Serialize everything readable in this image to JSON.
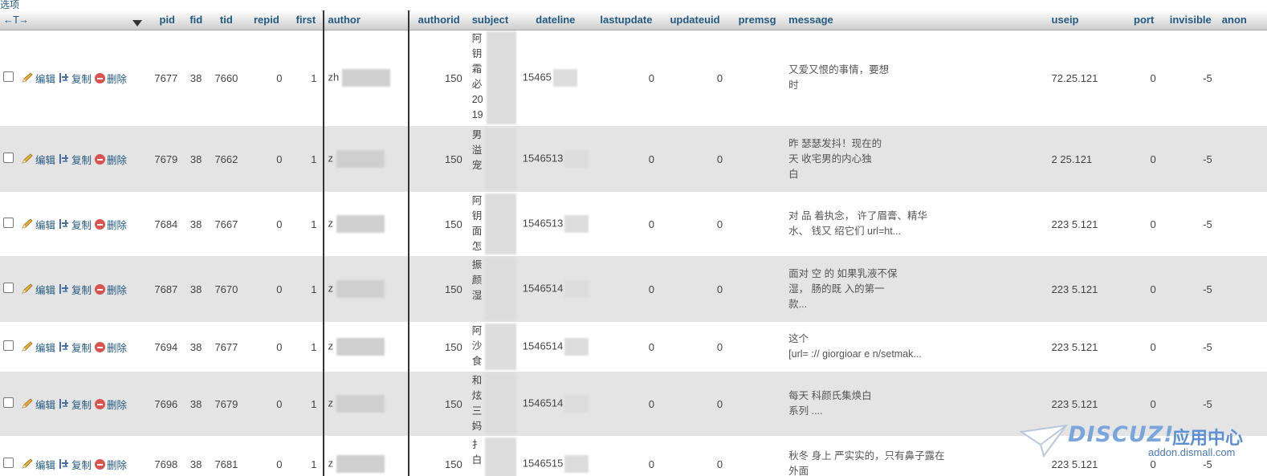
{
  "top_link": "选项",
  "header": {
    "nav": "←T→",
    "columns": [
      "pid",
      "fid",
      "tid",
      "repid",
      "first",
      "author",
      "authorid",
      "subject",
      "dateline",
      "lastupdate",
      "updateuid",
      "premsg",
      "message",
      "useip",
      "port",
      "invisible",
      "anon"
    ]
  },
  "actions": {
    "edit": "编辑",
    "copy": "复制",
    "delete": "删除"
  },
  "rows": [
    {
      "pid": "7677",
      "fid": "38",
      "tid": "7660",
      "repid": "0",
      "first": "1",
      "author": "zh",
      "authorid": "150",
      "subject": [
        "阿",
        "钥",
        "霜",
        "必",
        "20",
        "19"
      ],
      "dateline": "15465",
      "lastupdate": "0",
      "updateuid": "0",
      "message": [
        "",
        "又爱又恨的事情，要想",
        "时"
      ],
      "useip": "72.25.121",
      "port": "0",
      "invisible": "-5"
    },
    {
      "pid": "7679",
      "fid": "38",
      "tid": "7662",
      "repid": "0",
      "first": "1",
      "author": "z",
      "authorid": "150",
      "subject": [
        "男",
        "溢",
        "宠"
      ],
      "dateline": "1546513",
      "lastupdate": "0",
      "updateuid": "0",
      "message": [
        "昨                                    瑟瑟发抖！现在的",
        "天                                   收宅男的内心独",
        "白"
      ],
      "useip": "2   25.121",
      "port": "0",
      "invisible": "-5"
    },
    {
      "pid": "7684",
      "fid": "38",
      "tid": "7667",
      "repid": "0",
      "first": "1",
      "author": "z",
      "authorid": "150",
      "subject": [
        "阿",
        "钥",
        "面",
        "怎"
      ],
      "dateline": "1546513",
      "lastupdate": "0",
      "updateuid": "0",
      "message": [
        "对          品     着执念，     许了眉膏、精华",
        "水、        钱又    绍它们     url=ht..."
      ],
      "useip": "223   5.121",
      "port": "0",
      "invisible": "-5"
    },
    {
      "pid": "7687",
      "fid": "38",
      "tid": "7670",
      "repid": "0",
      "first": "1",
      "author": "z",
      "authorid": "150",
      "subject": [
        "振",
        "颜",
        "湿"
      ],
      "dateline": "1546514",
      "lastupdate": "0",
      "updateuid": "0",
      "message": [
        "面对          空     的    如果乳液不保",
        "湿，        肠的既        入的第一",
        "款..."
      ],
      "useip": "223   5.121",
      "port": "0",
      "invisible": "-5"
    },
    {
      "pid": "7694",
      "fid": "38",
      "tid": "7677",
      "repid": "0",
      "first": "1",
      "author": "z",
      "authorid": "150",
      "subject": [
        "阿",
        "沙",
        "食"
      ],
      "dateline": "1546514",
      "lastupdate": "0",
      "updateuid": "0",
      "message": [
        "这个",
        "[url=     ://    giorgioar      e     n/setmak..."
      ],
      "useip": "223   5.121",
      "port": "0",
      "invisible": "-5"
    },
    {
      "pid": "7696",
      "fid": "38",
      "tid": "7679",
      "repid": "0",
      "first": "1",
      "author": "z",
      "authorid": "150",
      "subject": [
        "和",
        "炫",
        "三",
        "妈"
      ],
      "dateline": "1546514",
      "lastupdate": "0",
      "updateuid": "0",
      "message": [
        "每天          科颜氏集焕白",
        "系列              ...."
      ],
      "useip": "223   5.121",
      "port": "0",
      "invisible": "-5"
    },
    {
      "pid": "7698",
      "fid": "38",
      "tid": "7681",
      "repid": "0",
      "first": "1",
      "author": "z",
      "authorid": "150",
      "subject": [
        "扌",
        "白"
      ],
      "dateline": "1546515",
      "lastupdate": "0",
      "updateuid": "0",
      "message": [
        "秋冬     身上        严实实的，只有鼻子露在",
        "外面       "
      ],
      "useip": "223   5.121",
      "port": "0",
      "invisible": "-5"
    }
  ],
  "watermark": {
    "logo": "DISCUZ!",
    "cn": "应用中心",
    "url": "addon.dismall.com"
  }
}
